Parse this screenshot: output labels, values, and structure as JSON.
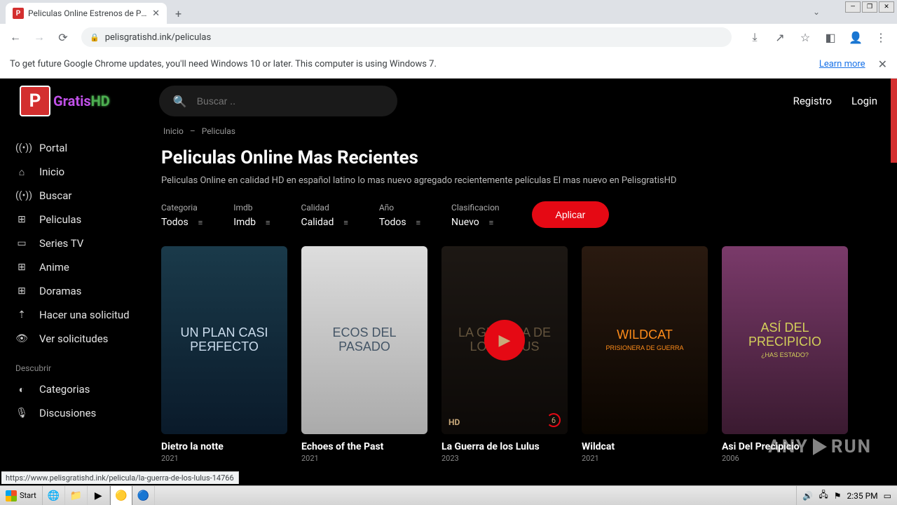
{
  "browser": {
    "tab_title": "Peliculas Online Estrenos de Pelicula",
    "url": "pelisgratishd.ink/peliculas",
    "info_bar_msg": "To get future Google Chrome updates, you'll need Windows 10 or later. This computer is using Windows 7.",
    "learn_more": "Learn more"
  },
  "logo": {
    "p": "P",
    "rest1": "Gratis",
    "rest2": "HD"
  },
  "search": {
    "placeholder": "Buscar .."
  },
  "auth": {
    "register": "Registro",
    "login": "Login"
  },
  "sidebar": {
    "items": [
      {
        "icon": "((•))",
        "label": "Portal"
      },
      {
        "icon": "⌂",
        "label": "Inicio"
      },
      {
        "icon": "((•))",
        "label": "Buscar"
      },
      {
        "icon": "⊞",
        "label": "Peliculas"
      },
      {
        "icon": "▭",
        "label": "Series TV"
      },
      {
        "icon": "⊞",
        "label": "Anime"
      },
      {
        "icon": "⊞",
        "label": "Doramas"
      },
      {
        "icon": "⇡",
        "label": "Hacer una solicitud"
      },
      {
        "icon": "👁",
        "label": "Ver solicitudes"
      }
    ],
    "section2_label": "Descubrir",
    "items2": [
      {
        "icon": "◐",
        "label": "Categorias"
      },
      {
        "icon": "🎙",
        "label": "Discusiones"
      }
    ]
  },
  "breadcrumb": {
    "a": "Inicio",
    "sep": "–",
    "b": "Peliculas"
  },
  "page": {
    "title": "Peliculas Online Mas Recientes",
    "subtitle": "Peliculas Online en calidad HD en español latino lo mas nuevo agregado recientemente películas El mas nuevo en PelisgratisHD"
  },
  "filters": [
    {
      "label": "Categoria",
      "value": "Todos"
    },
    {
      "label": "Imdb",
      "value": "Imdb"
    },
    {
      "label": "Calidad",
      "value": "Calidad"
    },
    {
      "label": "Año",
      "value": "Todos"
    },
    {
      "label": "Clasificacion",
      "value": "Nuevo"
    }
  ],
  "apply_label": "Aplicar",
  "movies": [
    {
      "art": "UN PLAN CASI PEЯFECTO",
      "title": "Dietro la notte",
      "year": "2021",
      "cls": "p1"
    },
    {
      "art": "ECOS DEL PASADO",
      "title": "Echoes of the Past",
      "year": "2021",
      "cls": "p2"
    },
    {
      "art": "LA GUERRA DE LOS LULUS",
      "title": "La Guerra de los Lulus",
      "year": "2023",
      "cls": "p3",
      "hover": true,
      "hd": "HD",
      "count": "6"
    },
    {
      "art": "WILDCAT",
      "sub": "PRISIONERA DE GUERRA",
      "title": "Wildcat",
      "year": "2021",
      "cls": "p4"
    },
    {
      "art": "ASÍ DEL PRECIPICIO",
      "sub": "¿HAS ESTADO?",
      "title": "Asi Del Precipicio",
      "year": "2006",
      "cls": "p5"
    }
  ],
  "status_url": "https://www.pelisgratishd.ink/pelicula/la-guerra-de-los-lulus-14766",
  "watermark": {
    "a": "ANY",
    "b": "RUN"
  },
  "taskbar": {
    "start": "Start",
    "clock": "2:35 PM"
  }
}
